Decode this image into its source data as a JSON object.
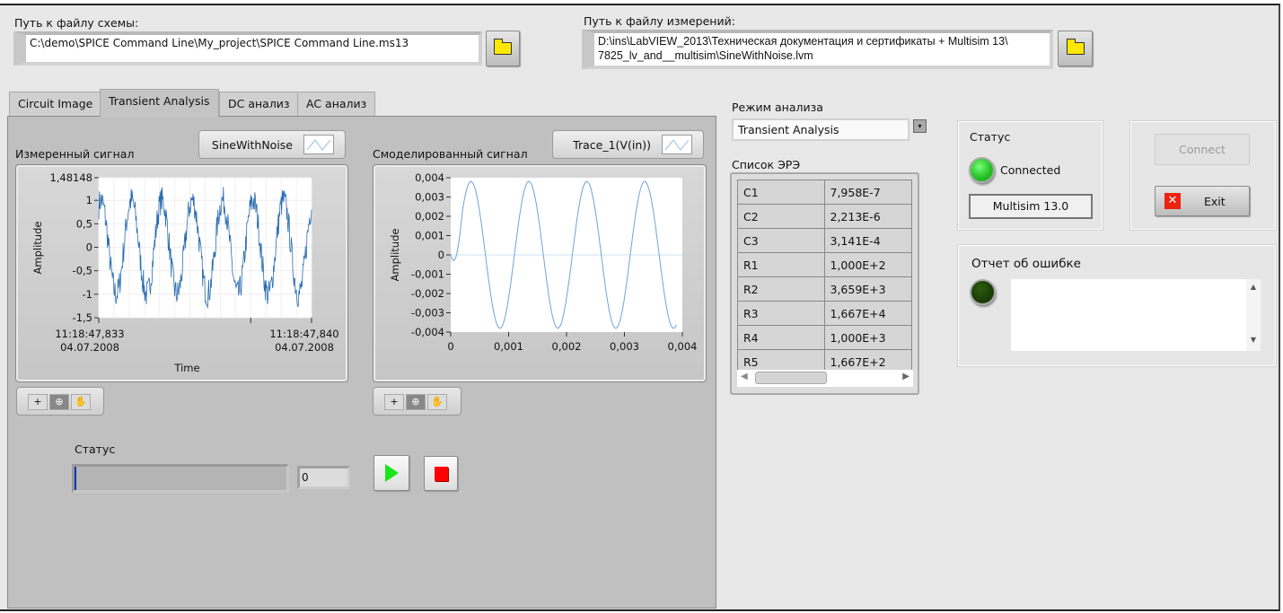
{
  "schematic_path": {
    "label": "Путь к файлу схемы:",
    "value": "C:\\demo\\SPICE Command Line\\My_project\\SPICE Command Line.ms13"
  },
  "measure_path": {
    "label": "Путь к файлу измерений:",
    "value_line1": "D:\\ins\\LabVIEW_2013\\Техническая документация и сертификаты + Multisim 13\\",
    "value_line2": "7825_lv_and__multisim\\SineWithNoise.lvm"
  },
  "tabs": [
    {
      "label": "Circuit Image"
    },
    {
      "label": "Transient Analysis"
    },
    {
      "label": "DC анализ"
    },
    {
      "label": "AC анализ"
    }
  ],
  "progress": {
    "label": "Статус",
    "value": 0,
    "numeric": "0"
  },
  "mode": {
    "label": "Режим анализа",
    "value": "Transient Analysis"
  },
  "components": {
    "label": "Список ЭРЭ",
    "rows": [
      [
        "C1",
        "7,958E-7"
      ],
      [
        "C2",
        "2,213E-6"
      ],
      [
        "C3",
        "3,141E-4"
      ],
      [
        "R1",
        "1,000E+2"
      ],
      [
        "R2",
        "3,659E+3"
      ],
      [
        "R3",
        "1,667E+4"
      ],
      [
        "R4",
        "1,000E+3"
      ],
      [
        "R5",
        "1,667E+2"
      ]
    ]
  },
  "status": {
    "label": "Статус",
    "text": "Connected",
    "version": "Multisim 13.0",
    "led_color": "#33cc22"
  },
  "buttons": {
    "connect": "Connect",
    "exit": "Exit"
  },
  "error": {
    "label": "Отчет об ошибке",
    "text": "",
    "led_color": "#1e4a08"
  },
  "chart_data": [
    {
      "type": "line",
      "title": "Измеренный сигнал",
      "legend": "SineWithNoise",
      "xlabel": "Time",
      "ylabel": "Amplitude",
      "ylim": [
        -1.5,
        1.48148
      ],
      "yticks": [
        "1,48148",
        "1",
        "0,5",
        "0",
        "-0,5",
        "-1",
        "-1,5"
      ],
      "xticks": [
        {
          "time": "11:18:47,833",
          "date": "04.07.2008"
        },
        {
          "time": "11:18:47,840",
          "date": "04.07.2008"
        }
      ],
      "xlim": [
        0,
        0.007
      ],
      "series": [
        {
          "name": "SineWithNoise",
          "frequency_hz": 1000,
          "amplitude": 1.0,
          "noise": 0.3,
          "color": "#2a6db0"
        }
      ]
    },
    {
      "type": "line",
      "title": "Смоделированный сигнал",
      "legend": "Trace_1(V(in))",
      "xlabel": "",
      "ylabel": "Amplitude",
      "ylim": [
        -0.004,
        0.004
      ],
      "xlim": [
        0,
        0.004
      ],
      "yticks": [
        "0,004",
        "0,003",
        "0,002",
        "0,001",
        "0",
        "-0,001",
        "-0,002",
        "-0,003",
        "-0,004"
      ],
      "xticks": [
        "0",
        "0,001",
        "0,002",
        "0,003",
        "0,004"
      ],
      "series": [
        {
          "name": "Trace_1(V(in))",
          "frequency_hz": 1000,
          "amplitude": 0.0038,
          "x_end": 0.0039,
          "color": "#6fa3d6"
        }
      ]
    }
  ]
}
